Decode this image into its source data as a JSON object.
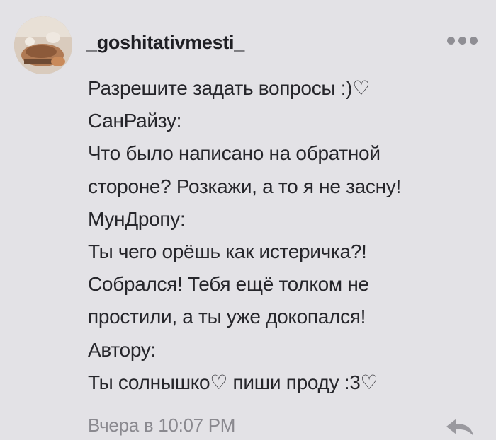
{
  "comment": {
    "username": "_goshitativmesti_",
    "lines": [
      "Разрешите задать вопросы :)♡",
      "СанРайзу:",
      "Что было написано на обратной",
      "стороне? Розкажи, а то я не засну!",
      "МунДропу:",
      "Ты чего орёшь как истеричка?!",
      "Собрался! Тебя ещё толком не",
      "простили, а ты уже докопался!",
      "Автору:",
      "Ты солнышко♡ пиши проду :3♡"
    ],
    "timestamp": "Вчера в 10:07 PM"
  },
  "icons": {
    "more": "more-horizontal-icon",
    "reply": "reply-arrow-icon"
  },
  "colors": {
    "background": "#e3e2e6",
    "text": "#26262b",
    "muted": "#8a898f"
  }
}
